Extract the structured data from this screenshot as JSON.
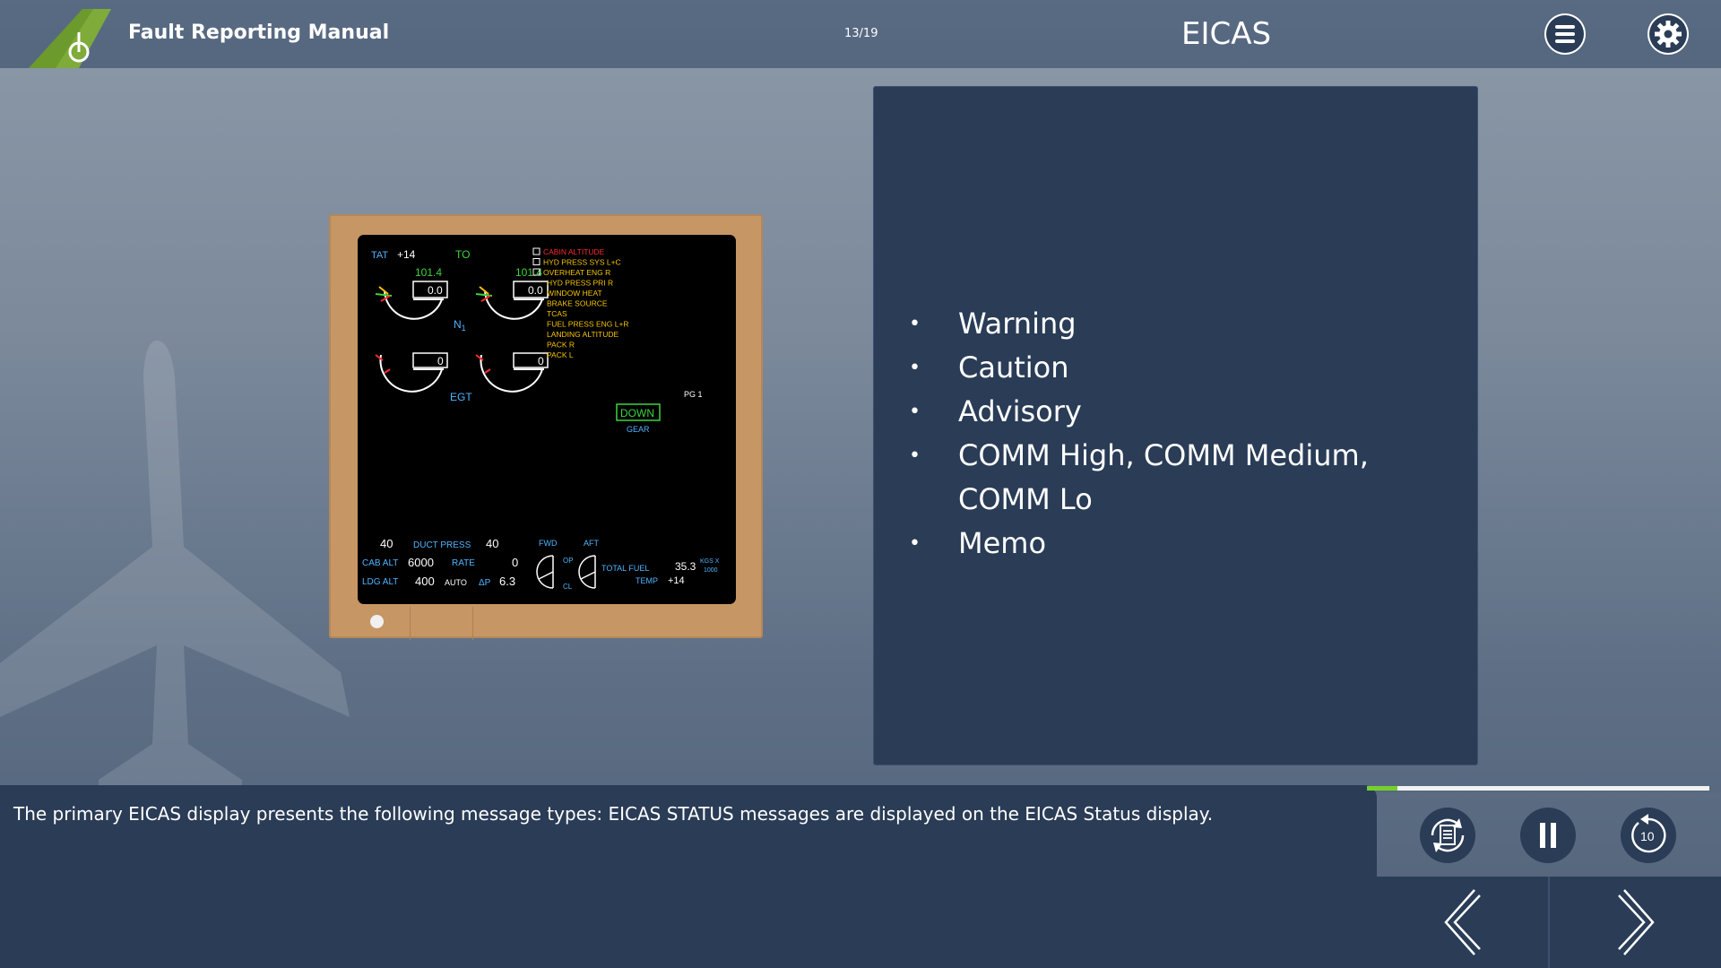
{
  "header": {
    "app_title": "Fault Reporting Manual",
    "page_count": "13/19",
    "section_title": "EICAS"
  },
  "eicas": {
    "tat_label": "TAT",
    "tat_value": "+14",
    "mode": "TO",
    "engines": [
      {
        "n1_value": "101.4",
        "n1_box": "0.0",
        "egt_box": "0"
      },
      {
        "n1_value": "101.4",
        "n1_box": "0.0",
        "egt_box": "0"
      }
    ],
    "n1_label": "N",
    "n1_sub": "1",
    "egt_label": "EGT",
    "messages": [
      {
        "text": "CABIN ALTITUDE",
        "color": "#ff2b2b",
        "checkbox": true
      },
      {
        "text": "HYD PRESS SYS L+C",
        "color": "#f5c400",
        "checkbox": true
      },
      {
        "text": "OVERHEAT ENG R",
        "color": "#f5c400",
        "checkbox": true
      },
      {
        "text": "HYD PRESS PRI R",
        "color": "#f5c400",
        "checkbox": false
      },
      {
        "text": "WINDOW HEAT",
        "color": "#f5c400",
        "checkbox": false
      },
      {
        "text": "BRAKE SOURCE",
        "color": "#f5c400",
        "checkbox": false
      },
      {
        "text": "TCAS",
        "color": "#f5c400",
        "checkbox": false
      },
      {
        "text": "FUEL PRESS ENG L+R",
        "color": "#f5c400",
        "checkbox": false
      },
      {
        "text": "LANDING ALTITUDE",
        "color": "#f5c400",
        "checkbox": false
      },
      {
        "text": "PACK R",
        "color": "#f5c400",
        "checkbox": false
      },
      {
        "text": "PACK L",
        "color": "#f5c400",
        "checkbox": false
      }
    ],
    "page_label": "PG 1",
    "gear_state": "DOWN",
    "gear_label": "GEAR",
    "duct_press_left": "40",
    "duct_press_label": "DUCT PRESS",
    "duct_press_right": "40",
    "fwd_label": "FWD",
    "aft_label": "AFT",
    "cab_alt_label": "CAB ALT",
    "cab_alt_value": "6000",
    "rate_label": "RATE",
    "rate_value": "0",
    "op_label": "OP",
    "cl_label": "CL",
    "total_fuel_label": "TOTAL FUEL",
    "total_fuel_value": "35.3",
    "fuel_unit_top": "KGS X",
    "fuel_unit_bottom": "1000",
    "ldg_alt_label": "LDG ALT",
    "ldg_alt_value": "400",
    "auto_label": "AUTO",
    "delta_p_label": "ΔP",
    "delta_p_value": "6.3",
    "temp_label": "TEMP",
    "temp_value": "+14"
  },
  "bullets": [
    "Warning",
    "Caution",
    "Advisory",
    "COMM High, COMM Medium, COMM Lo",
    "Memo"
  ],
  "narration": "The primary EICAS display presents the following message types: EICAS STATUS messages are displayed on the EICAS Status display.",
  "progress": {
    "fraction": 0.09,
    "fill_color": "#75d02e"
  },
  "controls": {
    "transcript": "transcript-icon",
    "pause": "pause-icon",
    "replay": "replay-10-icon",
    "replay_label": "10"
  },
  "colors": {
    "panel": "#2a3c56",
    "frame": "#c69665",
    "eicas_cyan": "#4fb4ff",
    "eicas_green": "#3ed43e",
    "eicas_white": "#ffffff"
  }
}
